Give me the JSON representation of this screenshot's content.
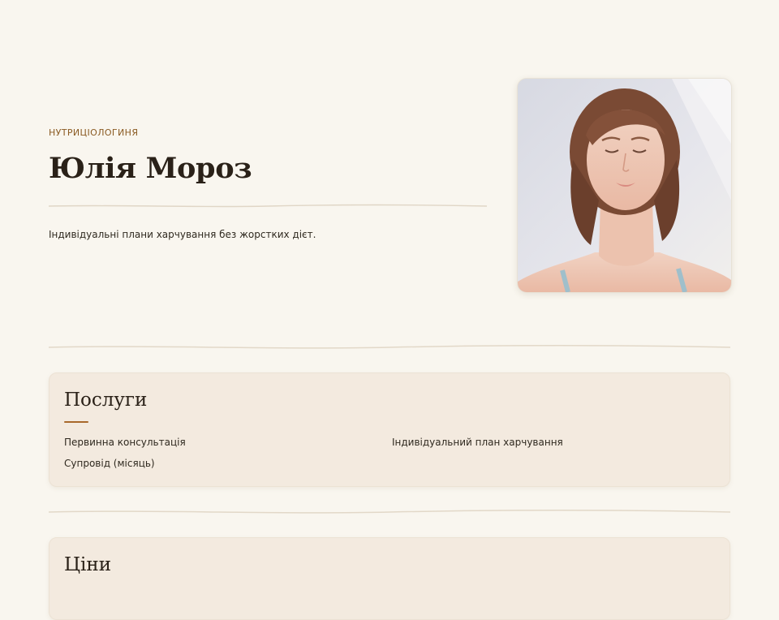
{
  "hero": {
    "eyebrow": "нутриціологиня",
    "name": "Юлія Мороз",
    "tagline": "Індивідуальні плани харчування без жорстких дієт.",
    "photo_alt": "portrait-photo"
  },
  "services": {
    "title": "Послуги",
    "items": [
      {
        "label": "Первинна консультація"
      },
      {
        "label": "Індивідуальний план харчування"
      },
      {
        "label": "Супровід (місяць)"
      }
    ]
  },
  "prices": {
    "title": "Ціни"
  },
  "colors": {
    "background": "#f9f6ef",
    "card": "#f3eadf",
    "accent": "#a8682b",
    "eyebrow": "#8a5a22"
  }
}
